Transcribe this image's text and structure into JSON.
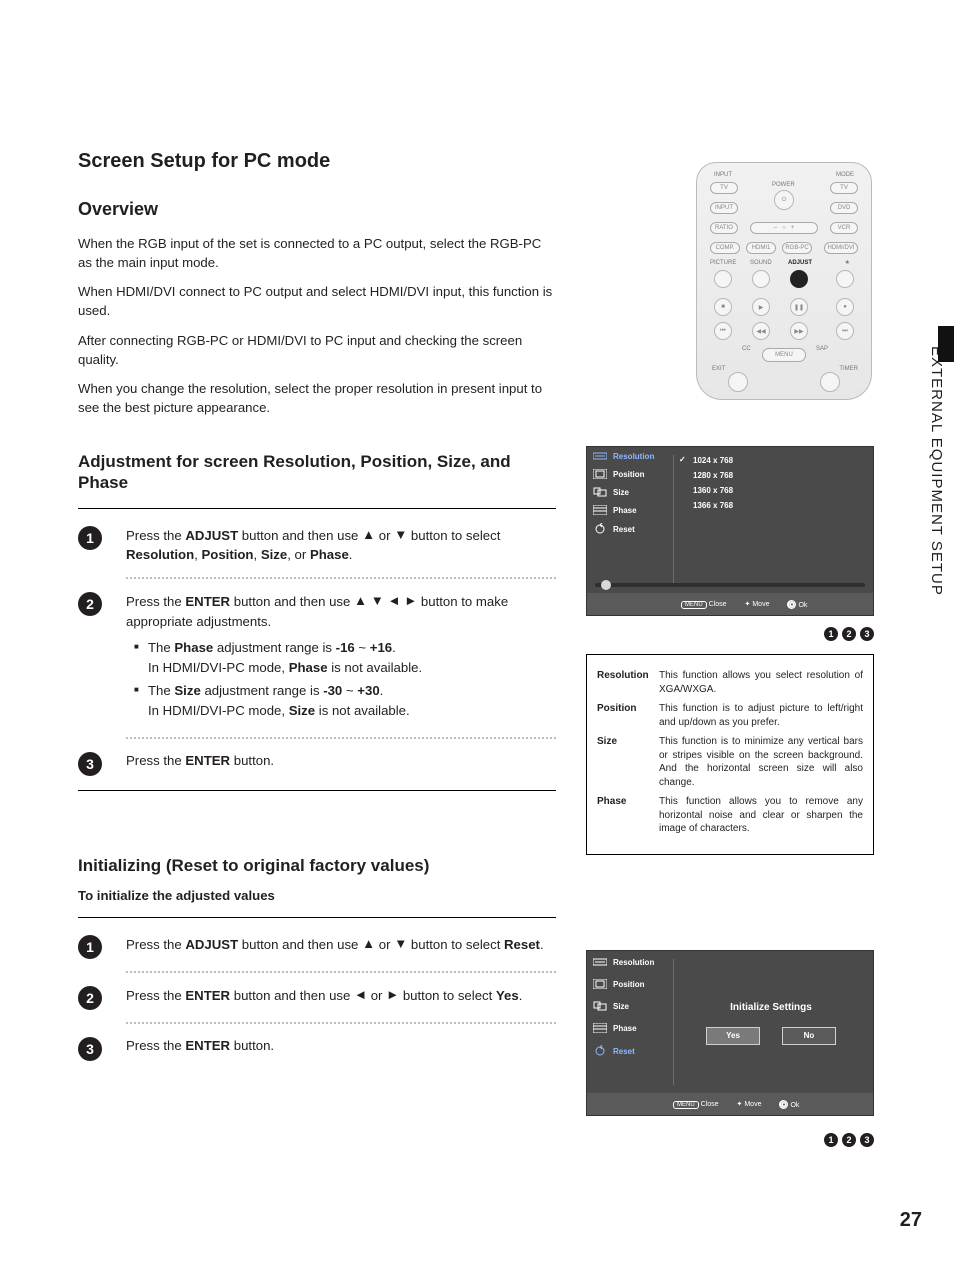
{
  "page_number": "27",
  "side_tab": "EXTERNAL EQUIPMENT SETUP",
  "h1": "Screen Setup for PC mode",
  "overview": {
    "heading": "Overview",
    "p1": "When the RGB input of the set is connected to a PC output, select the RGB-PC as the main input mode.",
    "p2": "When HDMI/DVI connect to PC output and select HDMI/DVI input, this function is used.",
    "p3": "After connecting RGB-PC or HDMI/DVI to PC input and checking the screen quality.",
    "p4": "When you change the resolution, select the proper resolution in present input to see the best picture appearance."
  },
  "adjust": {
    "heading": "Adjustment for screen Resolution, Position, Size, and Phase",
    "step1_a": "Press the ",
    "step1_btn": "ADJUST",
    "step1_b": " button and then use ",
    "step1_c": " or ",
    "step1_d": " button to select ",
    "step1_r": "Resolution",
    "step1_p": "Position",
    "step1_s": "Size",
    "step1_ph": "Phase",
    "step1_end": ".",
    "step2_a": "Press the ",
    "step2_btn": "ENTER",
    "step2_b": " button and then use ",
    "step2_c": " button to make appropriate adjustments.",
    "step2_li1_a": "The ",
    "step2_li1_phase": "Phase",
    "step2_li1_b": " adjustment range is ",
    "step2_li1_r1": "-16",
    "step2_li1_tilde": " ~ ",
    "step2_li1_r2": "+16",
    "step2_li1_c": ".",
    "step2_li1_d": "In HDMI/DVI-PC mode, ",
    "step2_li1_e": " is not available.",
    "step2_li2_size": "Size",
    "step2_li2_r1": "-30",
    "step2_li2_r2": "+30",
    "step3_a": "Press the ",
    "step3_btn": "ENTER",
    "step3_b": " button."
  },
  "init": {
    "heading": "Initializing (Reset to original factory values)",
    "sub": "To initialize the adjusted values",
    "step1_a": "Press the ",
    "step1_btn": "ADJUST",
    "step1_b": " button and then use ",
    "step1_c": " or ",
    "step1_d": " button to select ",
    "step1_reset": "Reset",
    "step1_end": ".",
    "step2_a": "Press the ",
    "step2_btn": "ENTER",
    "step2_b": " button and then use ",
    "step2_c": " or ",
    "step2_d": " button to select ",
    "step2_yes": "Yes",
    "step2_end": ".",
    "step3_a": "Press the ",
    "step3_btn": "ENTER",
    "step3_b": " button."
  },
  "remote": {
    "input": "INPUT",
    "mode": "MODE",
    "power": "POWER",
    "tv": "TV",
    "input_btn": "INPUT",
    "dvd": "DVD",
    "ratio": "RATIO",
    "minus": "–",
    "plus": "+",
    "vcr": "VCR",
    "comp": "COMP.",
    "hdmi1": "HDMI1",
    "rgbpc": "RGB-PC",
    "hdmi2": "HDMI/DVI",
    "picture": "PICTURE",
    "sound": "SOUND",
    "adjust": "ADJUST",
    "star": "★",
    "cc": "CC",
    "menu": "MENU",
    "sap": "SAP",
    "exit": "EXIT",
    "timer": "TIMER"
  },
  "osd1": {
    "nav": {
      "resolution": "Resolution",
      "position": "Position",
      "size": "Size",
      "phase": "Phase",
      "reset": "Reset"
    },
    "options": [
      "1024 x 768",
      "1280 x 768",
      "1360 x 768",
      "1366 x 768"
    ],
    "footer": {
      "menu": "MENU",
      "close": "Close",
      "move": "Move",
      "ok": "Ok"
    }
  },
  "defs": {
    "resolution_k": "Resolution",
    "resolution_v": "This function allows you select resolution of XGA/WXGA.",
    "position_k": "Position",
    "position_v": "This function is to adjust picture to left/right and up/down as you prefer.",
    "size_k": "Size",
    "size_v": "This function is to minimize any vertical bars or stripes visible on the screen background. And the horizontal screen size will also change.",
    "phase_k": "Phase",
    "phase_v": "This function allows you to remove any horizontal noise and clear or sharpen the image of characters."
  },
  "osd2": {
    "title": "Initialize Settings",
    "yes": "Yes",
    "no": "No",
    "footer": {
      "menu": "MENU",
      "close": "Close",
      "move": "Move",
      "ok": "Ok"
    }
  }
}
